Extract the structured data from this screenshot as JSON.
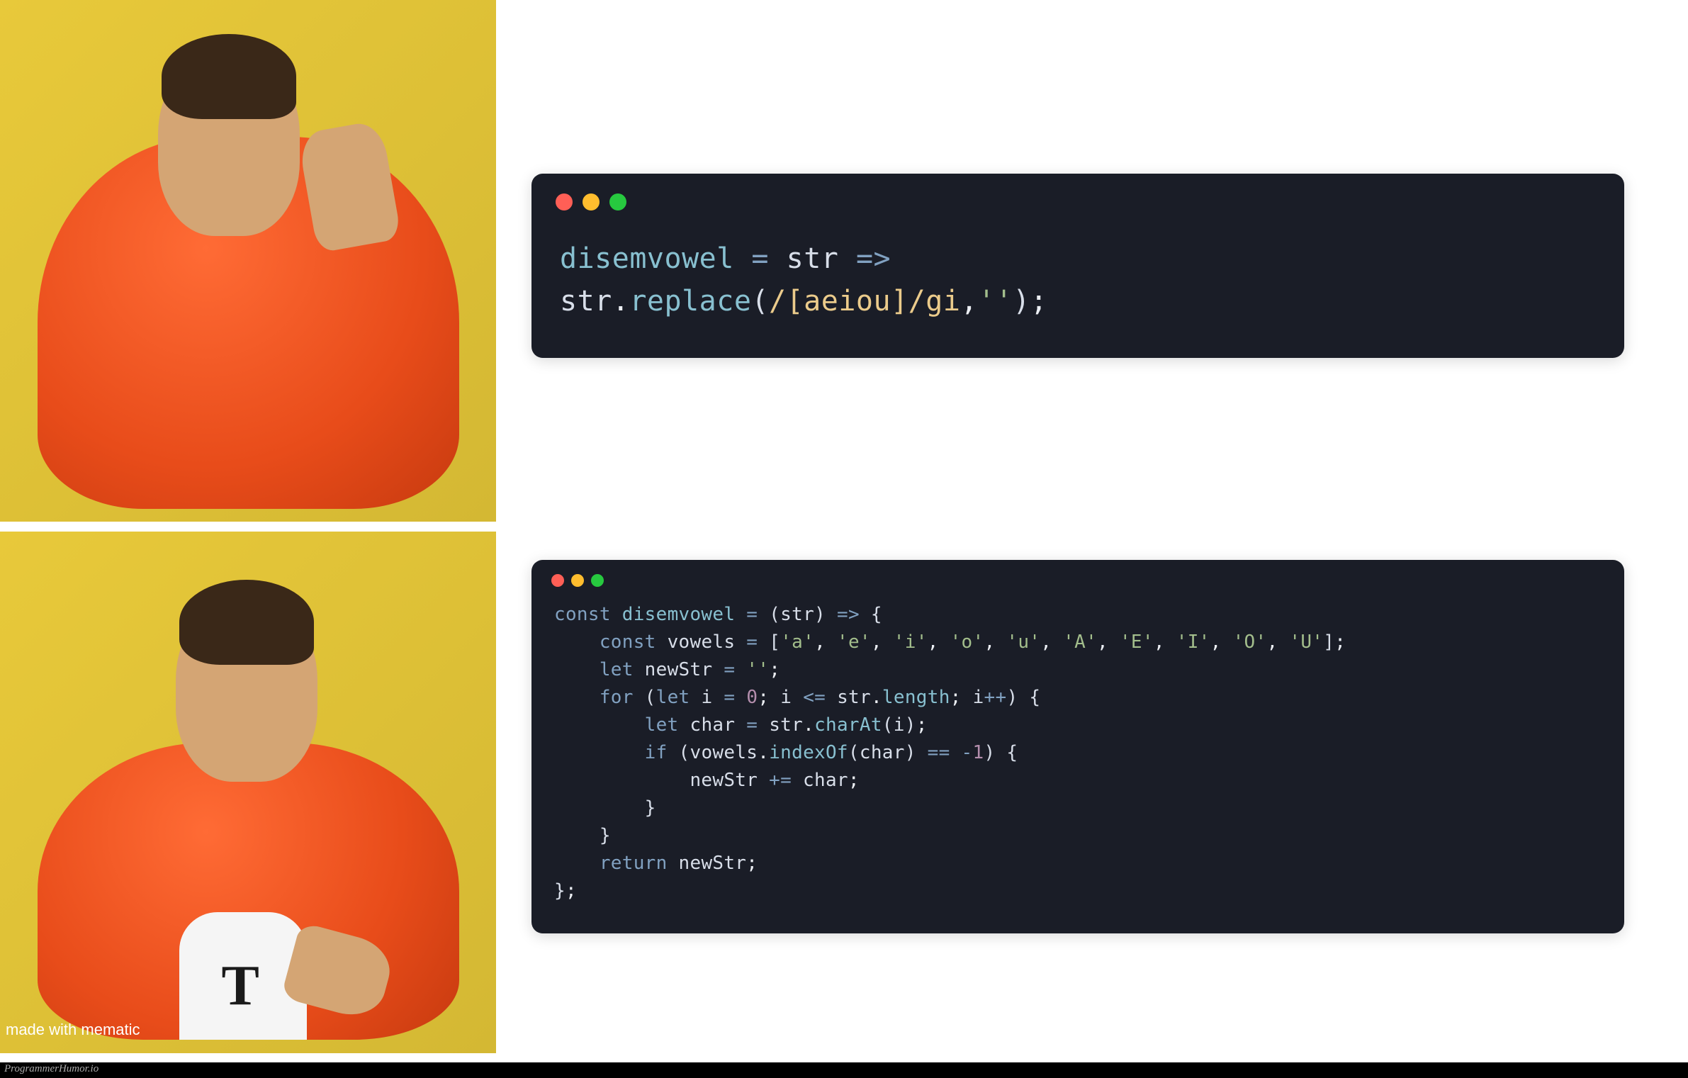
{
  "meme": {
    "format": "drake-style-reject-approve",
    "subject_description": "man in orange puffer jacket",
    "top_panel_action": "rejecting / disapproving gesture",
    "bottom_panel_action": "approving / pointing gesture",
    "bottom_shirt_logo": "T"
  },
  "code_top": {
    "language": "javascript",
    "tokens": [
      {
        "t": "disemvowel",
        "c": "ident"
      },
      {
        "t": " ",
        "c": "plain"
      },
      {
        "t": "=",
        "c": "op"
      },
      {
        "t": " ",
        "c": "plain"
      },
      {
        "t": "str",
        "c": "var"
      },
      {
        "t": " ",
        "c": "plain"
      },
      {
        "t": "=>",
        "c": "op"
      },
      {
        "t": "\n",
        "c": "plain"
      },
      {
        "t": "str",
        "c": "var"
      },
      {
        "t": ".",
        "c": "punct"
      },
      {
        "t": "replace",
        "c": "func"
      },
      {
        "t": "(",
        "c": "paren"
      },
      {
        "t": "/[aeiou]/gi",
        "c": "regex"
      },
      {
        "t": ",",
        "c": "punct"
      },
      {
        "t": "''",
        "c": "str"
      },
      {
        "t": ")",
        "c": "paren"
      },
      {
        "t": ";",
        "c": "punct"
      }
    ]
  },
  "code_bottom": {
    "language": "javascript",
    "tokens": [
      {
        "t": "const",
        "c": "keyword"
      },
      {
        "t": " ",
        "c": "plain"
      },
      {
        "t": "disemvowel",
        "c": "ident"
      },
      {
        "t": " ",
        "c": "plain"
      },
      {
        "t": "=",
        "c": "op"
      },
      {
        "t": " ",
        "c": "plain"
      },
      {
        "t": "(",
        "c": "paren"
      },
      {
        "t": "str",
        "c": "var"
      },
      {
        "t": ")",
        "c": "paren"
      },
      {
        "t": " ",
        "c": "plain"
      },
      {
        "t": "=>",
        "c": "op"
      },
      {
        "t": " ",
        "c": "plain"
      },
      {
        "t": "{",
        "c": "paren"
      },
      {
        "t": "\n    ",
        "c": "plain"
      },
      {
        "t": "const",
        "c": "keyword"
      },
      {
        "t": " ",
        "c": "plain"
      },
      {
        "t": "vowels",
        "c": "var"
      },
      {
        "t": " ",
        "c": "plain"
      },
      {
        "t": "=",
        "c": "op"
      },
      {
        "t": " ",
        "c": "plain"
      },
      {
        "t": "[",
        "c": "paren"
      },
      {
        "t": "'a'",
        "c": "str"
      },
      {
        "t": ", ",
        "c": "punct"
      },
      {
        "t": "'e'",
        "c": "str"
      },
      {
        "t": ", ",
        "c": "punct"
      },
      {
        "t": "'i'",
        "c": "str"
      },
      {
        "t": ", ",
        "c": "punct"
      },
      {
        "t": "'o'",
        "c": "str"
      },
      {
        "t": ", ",
        "c": "punct"
      },
      {
        "t": "'u'",
        "c": "str"
      },
      {
        "t": ", ",
        "c": "punct"
      },
      {
        "t": "'A'",
        "c": "str"
      },
      {
        "t": ", ",
        "c": "punct"
      },
      {
        "t": "'E'",
        "c": "str"
      },
      {
        "t": ", ",
        "c": "punct"
      },
      {
        "t": "'I'",
        "c": "str"
      },
      {
        "t": ", ",
        "c": "punct"
      },
      {
        "t": "'O'",
        "c": "str"
      },
      {
        "t": ", ",
        "c": "punct"
      },
      {
        "t": "'U'",
        "c": "str"
      },
      {
        "t": "]",
        "c": "paren"
      },
      {
        "t": ";",
        "c": "punct"
      },
      {
        "t": "\n    ",
        "c": "plain"
      },
      {
        "t": "let",
        "c": "keyword"
      },
      {
        "t": " ",
        "c": "plain"
      },
      {
        "t": "newStr",
        "c": "var"
      },
      {
        "t": " ",
        "c": "plain"
      },
      {
        "t": "=",
        "c": "op"
      },
      {
        "t": " ",
        "c": "plain"
      },
      {
        "t": "''",
        "c": "str"
      },
      {
        "t": ";",
        "c": "punct"
      },
      {
        "t": "\n    ",
        "c": "plain"
      },
      {
        "t": "for",
        "c": "keyword"
      },
      {
        "t": " ",
        "c": "plain"
      },
      {
        "t": "(",
        "c": "paren"
      },
      {
        "t": "let",
        "c": "keyword"
      },
      {
        "t": " ",
        "c": "plain"
      },
      {
        "t": "i",
        "c": "var"
      },
      {
        "t": " ",
        "c": "plain"
      },
      {
        "t": "=",
        "c": "op"
      },
      {
        "t": " ",
        "c": "plain"
      },
      {
        "t": "0",
        "c": "num"
      },
      {
        "t": "; ",
        "c": "punct"
      },
      {
        "t": "i",
        "c": "var"
      },
      {
        "t": " ",
        "c": "plain"
      },
      {
        "t": "<=",
        "c": "op"
      },
      {
        "t": " ",
        "c": "plain"
      },
      {
        "t": "str",
        "c": "var"
      },
      {
        "t": ".",
        "c": "punct"
      },
      {
        "t": "length",
        "c": "ident"
      },
      {
        "t": "; ",
        "c": "punct"
      },
      {
        "t": "i",
        "c": "var"
      },
      {
        "t": "++",
        "c": "op"
      },
      {
        "t": ")",
        "c": "paren"
      },
      {
        "t": " ",
        "c": "plain"
      },
      {
        "t": "{",
        "c": "paren"
      },
      {
        "t": "\n        ",
        "c": "plain"
      },
      {
        "t": "let",
        "c": "keyword"
      },
      {
        "t": " ",
        "c": "plain"
      },
      {
        "t": "char",
        "c": "var"
      },
      {
        "t": " ",
        "c": "plain"
      },
      {
        "t": "=",
        "c": "op"
      },
      {
        "t": " ",
        "c": "plain"
      },
      {
        "t": "str",
        "c": "var"
      },
      {
        "t": ".",
        "c": "punct"
      },
      {
        "t": "charAt",
        "c": "func"
      },
      {
        "t": "(",
        "c": "paren"
      },
      {
        "t": "i",
        "c": "var"
      },
      {
        "t": ")",
        "c": "paren"
      },
      {
        "t": ";",
        "c": "punct"
      },
      {
        "t": "\n        ",
        "c": "plain"
      },
      {
        "t": "if",
        "c": "keyword"
      },
      {
        "t": " ",
        "c": "plain"
      },
      {
        "t": "(",
        "c": "paren"
      },
      {
        "t": "vowels",
        "c": "var"
      },
      {
        "t": ".",
        "c": "punct"
      },
      {
        "t": "indexOf",
        "c": "func"
      },
      {
        "t": "(",
        "c": "paren"
      },
      {
        "t": "char",
        "c": "var"
      },
      {
        "t": ")",
        "c": "paren"
      },
      {
        "t": " ",
        "c": "plain"
      },
      {
        "t": "==",
        "c": "op"
      },
      {
        "t": " ",
        "c": "plain"
      },
      {
        "t": "-",
        "c": "op"
      },
      {
        "t": "1",
        "c": "num"
      },
      {
        "t": ")",
        "c": "paren"
      },
      {
        "t": " ",
        "c": "plain"
      },
      {
        "t": "{",
        "c": "paren"
      },
      {
        "t": "\n            ",
        "c": "plain"
      },
      {
        "t": "newStr",
        "c": "var"
      },
      {
        "t": " ",
        "c": "plain"
      },
      {
        "t": "+=",
        "c": "op"
      },
      {
        "t": " ",
        "c": "plain"
      },
      {
        "t": "char",
        "c": "var"
      },
      {
        "t": ";",
        "c": "punct"
      },
      {
        "t": "\n        ",
        "c": "plain"
      },
      {
        "t": "}",
        "c": "paren"
      },
      {
        "t": "\n    ",
        "c": "plain"
      },
      {
        "t": "}",
        "c": "paren"
      },
      {
        "t": "\n    ",
        "c": "plain"
      },
      {
        "t": "return",
        "c": "keyword"
      },
      {
        "t": " ",
        "c": "plain"
      },
      {
        "t": "newStr",
        "c": "var"
      },
      {
        "t": ";",
        "c": "punct"
      },
      {
        "t": "\n",
        "c": "plain"
      },
      {
        "t": "}",
        "c": "paren"
      },
      {
        "t": ";",
        "c": "punct"
      }
    ]
  },
  "watermarks": {
    "mematic": "made with mematic",
    "source": "ProgrammerHumor.io"
  }
}
